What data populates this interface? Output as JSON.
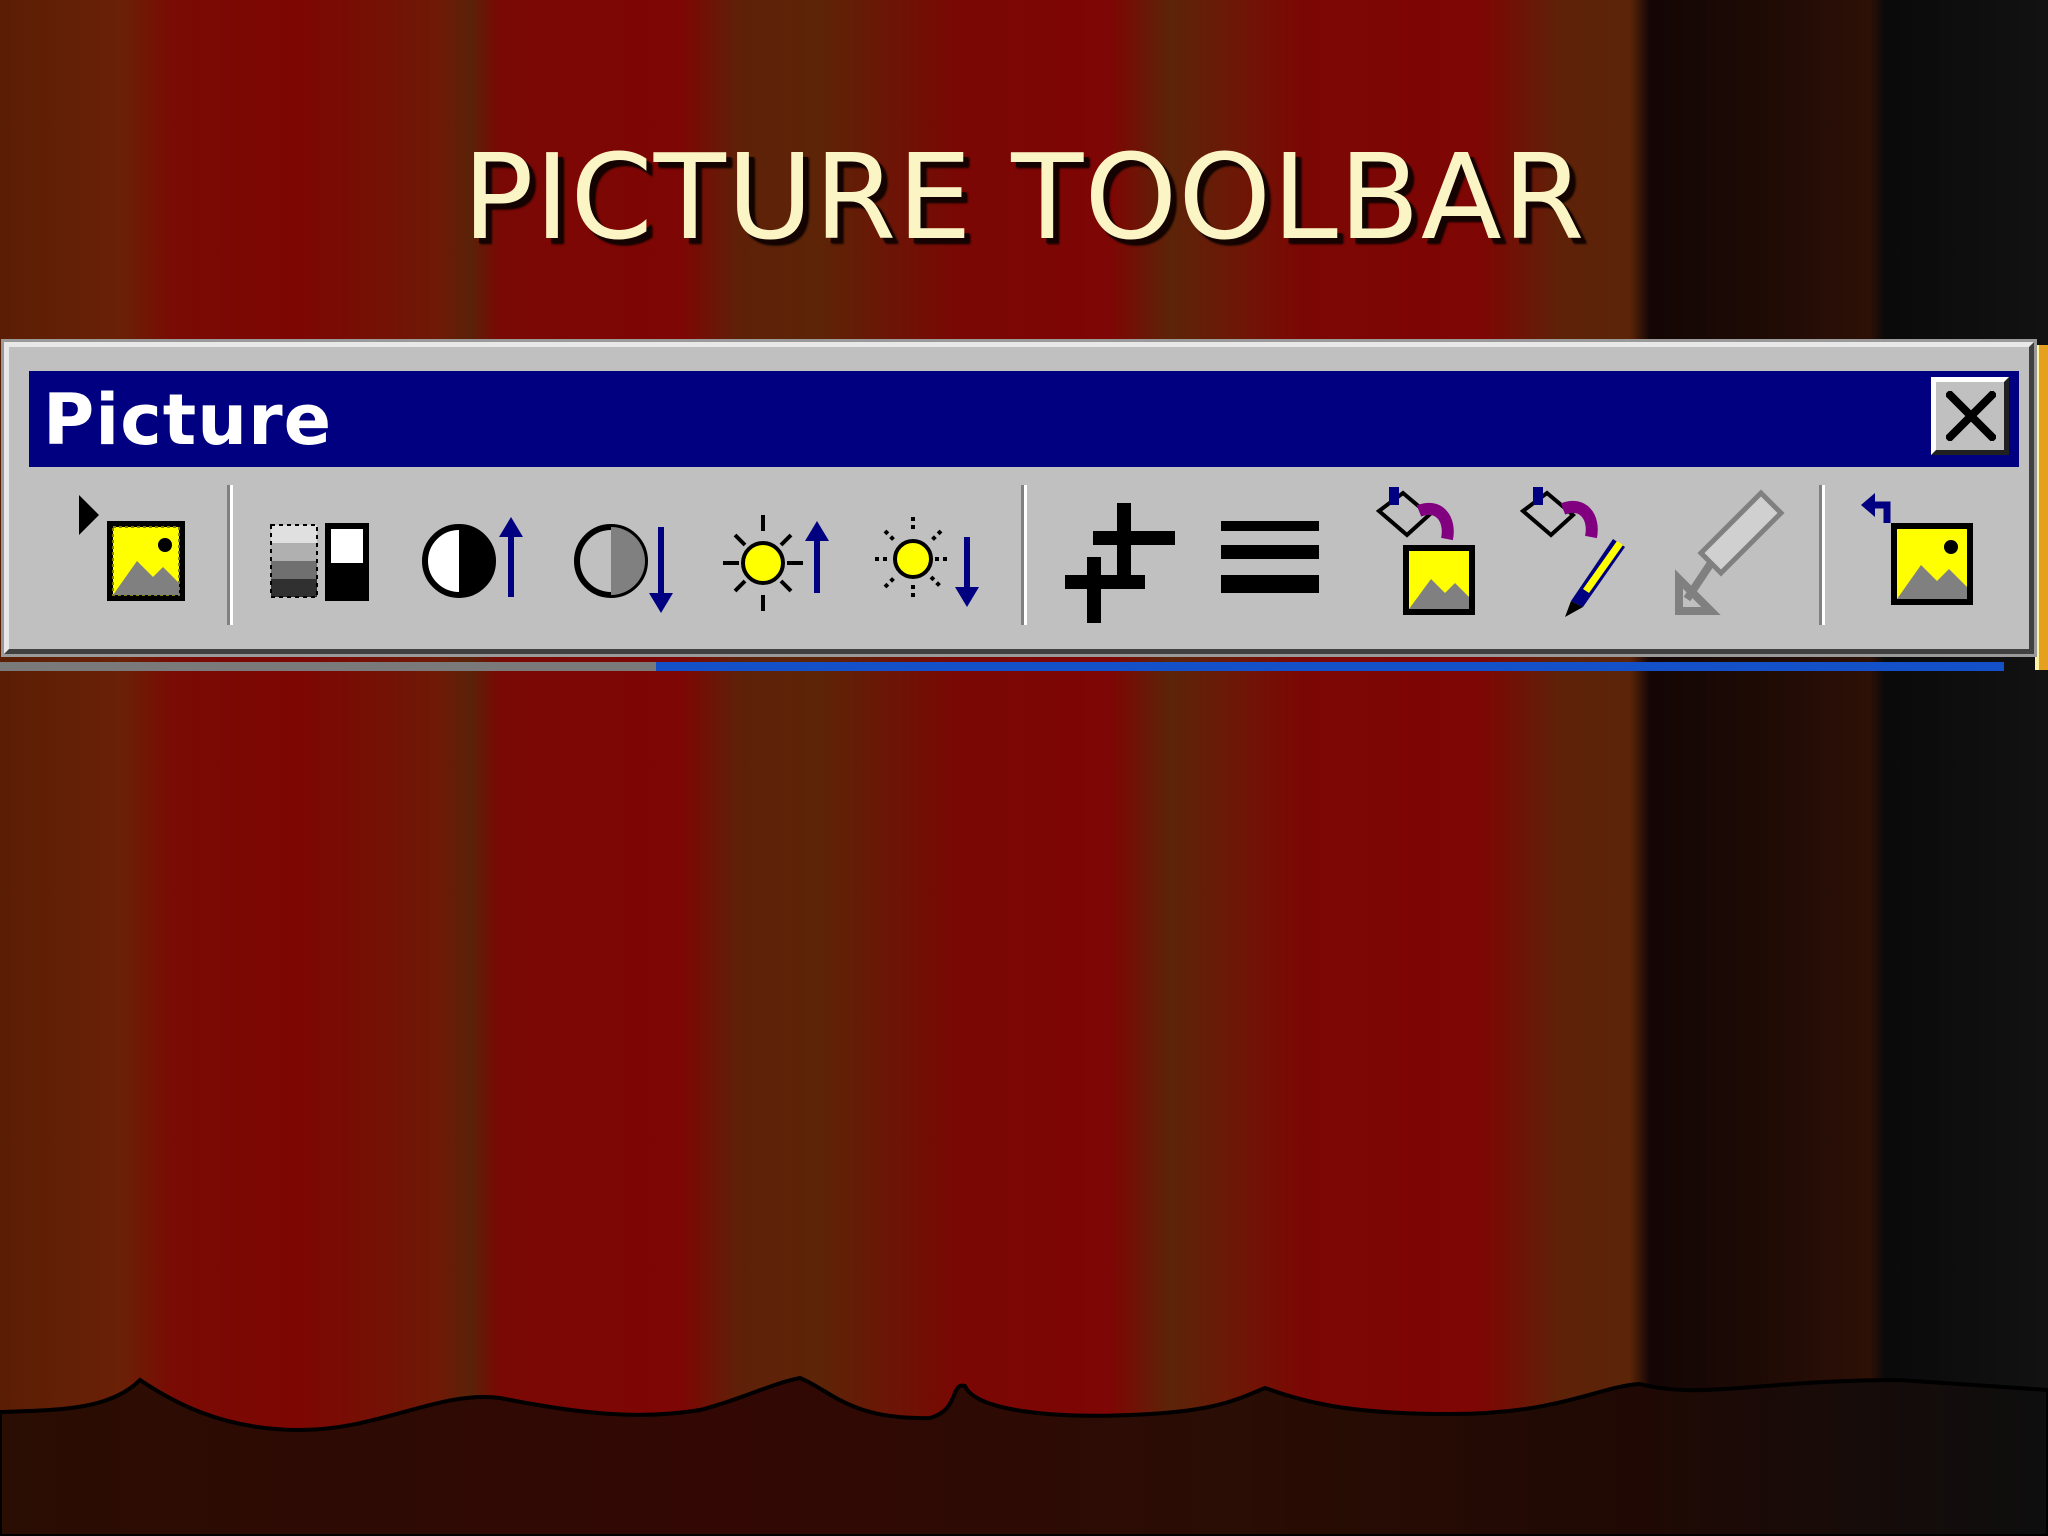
{
  "slide": {
    "title": "PICTURE TOOLBAR"
  },
  "window": {
    "title": "Picture",
    "close_glyph": "close-icon"
  },
  "toolbar": {
    "buttons": [
      {
        "name": "insert-picture",
        "icon": "insert-picture-icon"
      },
      {
        "name": "image-control",
        "icon": "image-control-icon"
      },
      {
        "name": "more-contrast",
        "icon": "more-contrast-icon"
      },
      {
        "name": "less-contrast",
        "icon": "less-contrast-icon"
      },
      {
        "name": "more-brightness",
        "icon": "more-brightness-icon"
      },
      {
        "name": "less-brightness",
        "icon": "less-brightness-icon"
      },
      {
        "name": "crop",
        "icon": "crop-icon"
      },
      {
        "name": "line-style",
        "icon": "line-style-icon"
      },
      {
        "name": "format-picture",
        "icon": "format-picture-icon"
      },
      {
        "name": "recolor-picture",
        "icon": "recolor-picture-icon"
      },
      {
        "name": "set-transparent-color",
        "icon": "set-transparent-color-icon"
      },
      {
        "name": "reset-picture",
        "icon": "reset-picture-icon"
      }
    ]
  },
  "colors": {
    "titlebar": "#000080",
    "title_text": "#fbf5c6",
    "toolbar_face": "#c0c0c0",
    "picture_yellow": "#ffff00",
    "arrow_blue": "#000080"
  }
}
